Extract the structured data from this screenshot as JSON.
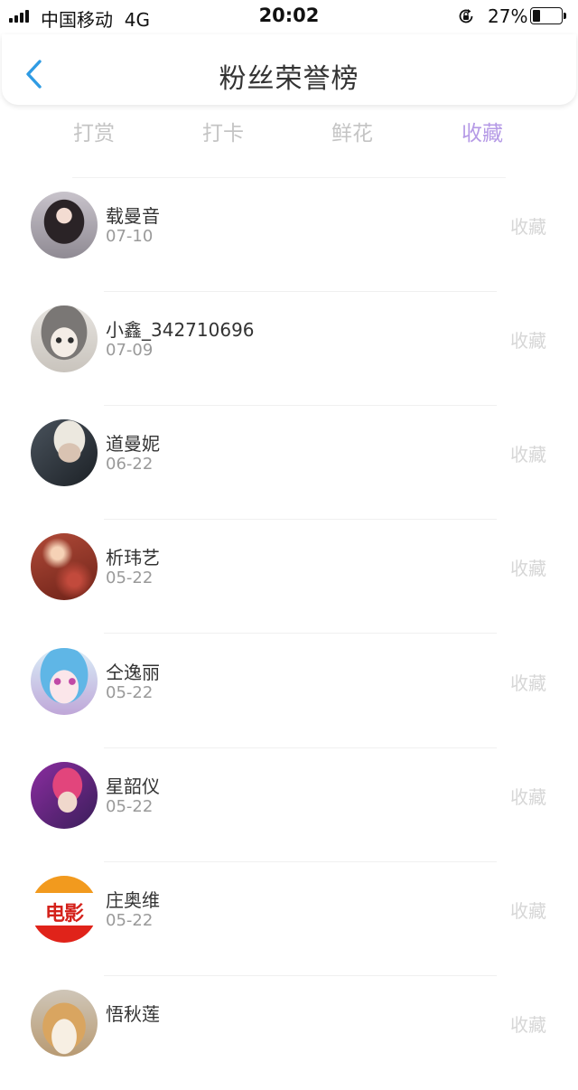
{
  "status_bar": {
    "carrier": "中国移动",
    "network": "4G",
    "time": "20:02",
    "battery_pct": "27%",
    "battery_level": 0.27
  },
  "header": {
    "title": "粉丝荣誉榜",
    "accent_color": "#2f9be3"
  },
  "tabs": [
    {
      "label": "打赏",
      "active": false
    },
    {
      "label": "打卡",
      "active": false
    },
    {
      "label": "鲜花",
      "active": false
    },
    {
      "label": "收藏",
      "active": true
    }
  ],
  "active_tab_color": "#b59ae6",
  "fans": [
    {
      "name": "载曼音",
      "date": "07-10",
      "action": "收藏",
      "avatar": "dark-hair-girl-photo"
    },
    {
      "name": "小鑫_342710696",
      "date": "07-09",
      "action": "收藏",
      "avatar": "sketch-cartoon-girl"
    },
    {
      "name": "道曼妮",
      "date": "06-22",
      "action": "收藏",
      "avatar": "blond-man-photo"
    },
    {
      "name": "析玮艺",
      "date": "05-22",
      "action": "收藏",
      "avatar": "red-bokeh-photo"
    },
    {
      "name": "仝逸丽",
      "date": "05-22",
      "action": "收藏",
      "avatar": "anime-girl"
    },
    {
      "name": "星韶仪",
      "date": "05-22",
      "action": "收藏",
      "avatar": "pink-hair-singer-photo"
    },
    {
      "name": "庄奥维",
      "date": "05-22",
      "action": "收藏",
      "avatar": "movie-logo",
      "avatar_text": "电影"
    },
    {
      "name": "悟秋莲",
      "date": "",
      "action": "收藏",
      "avatar": "cat-photo"
    }
  ]
}
